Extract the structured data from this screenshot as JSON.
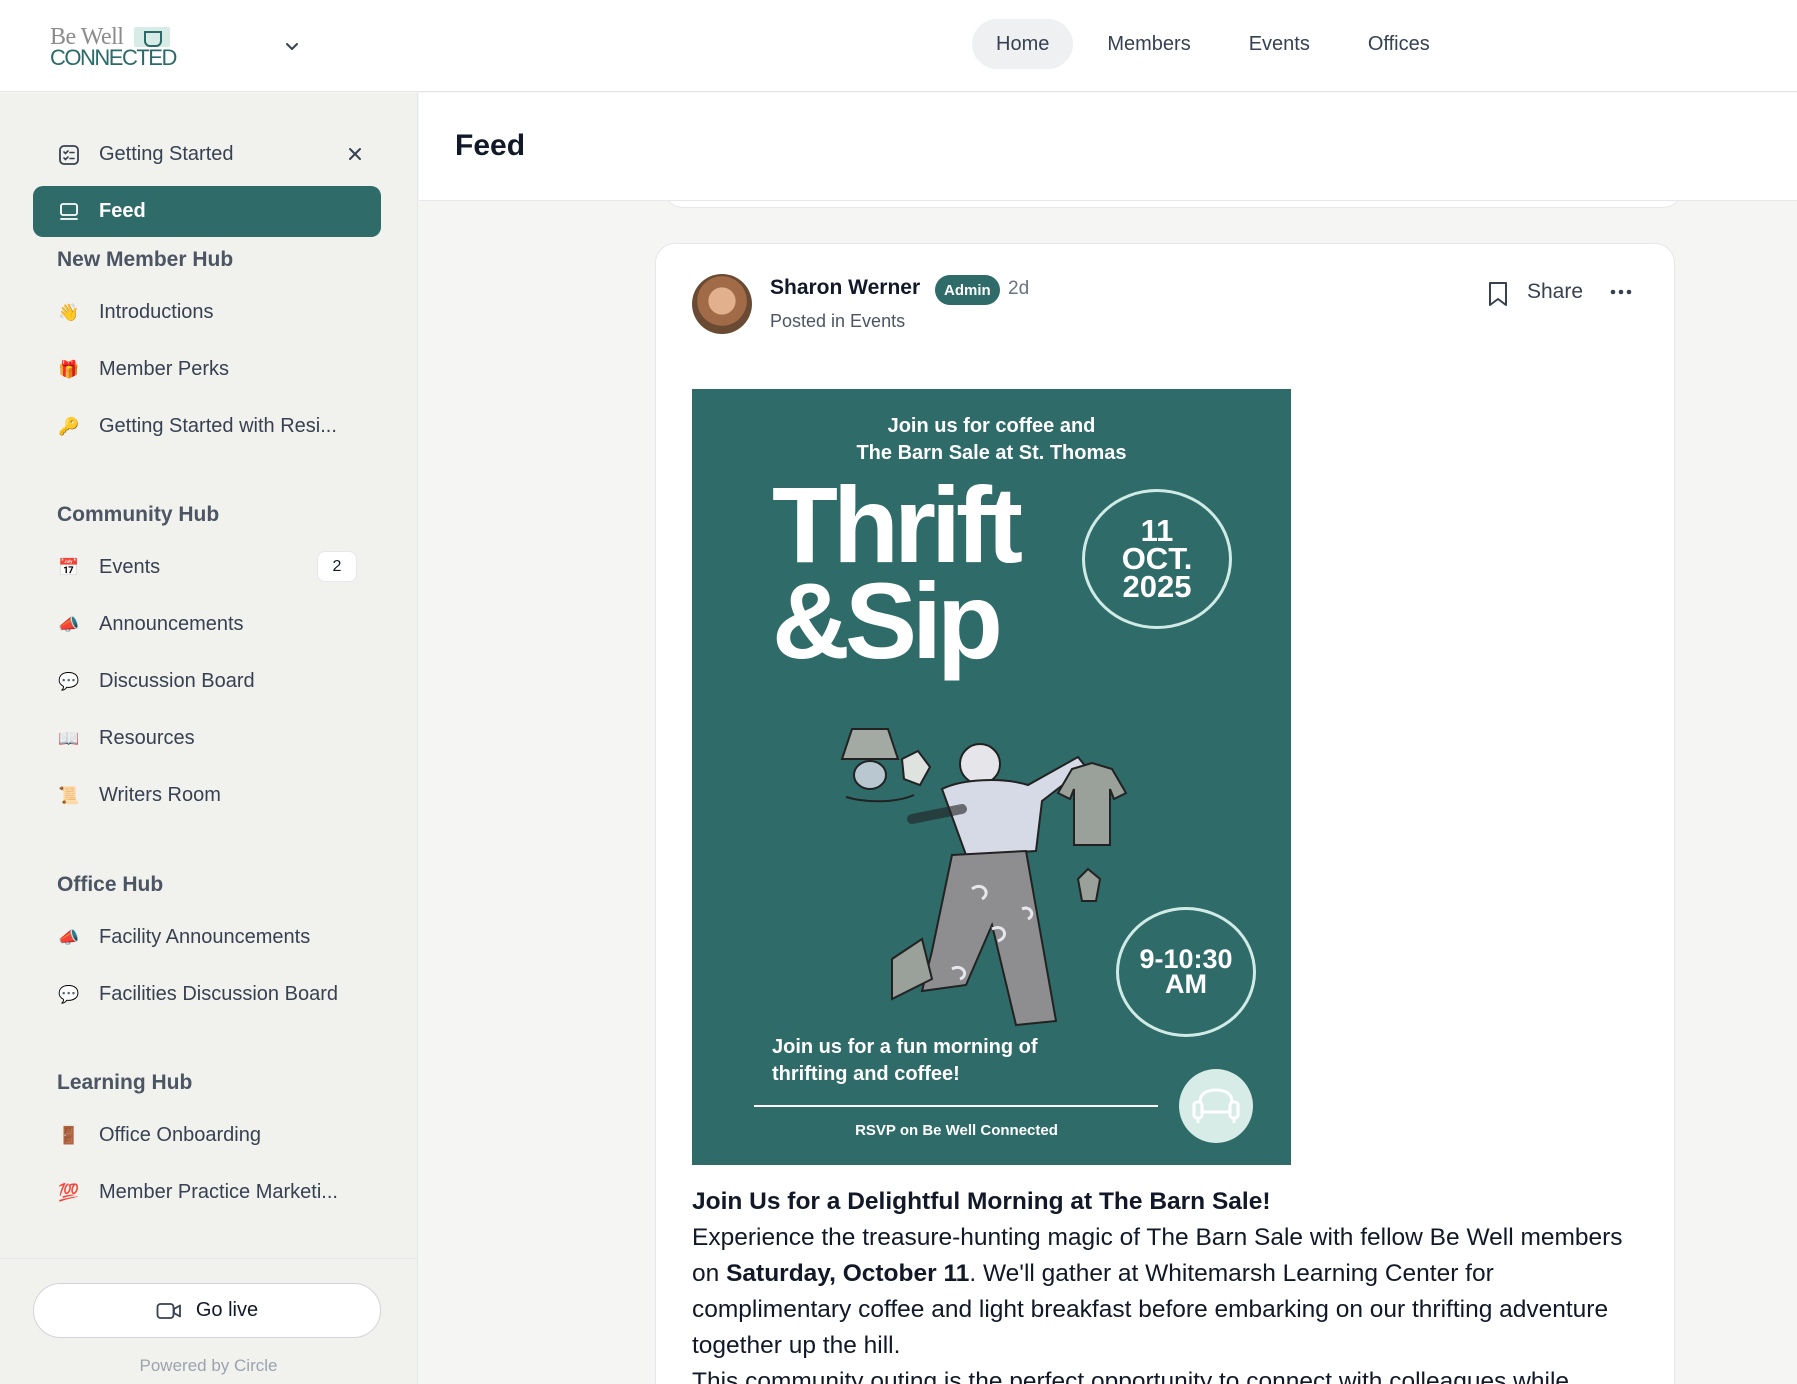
{
  "app": {
    "logo_line1": "Be Well",
    "logo_line2": "CONNECTED"
  },
  "topnav": [
    {
      "label": "Home",
      "active": true
    },
    {
      "label": "Members",
      "active": false
    },
    {
      "label": "Events",
      "active": false
    },
    {
      "label": "Offices",
      "active": false
    }
  ],
  "sidebar": {
    "getting_started": "Getting Started",
    "feed": "Feed",
    "groups": [
      {
        "heading": "New Member Hub",
        "items": [
          {
            "label": "Introductions",
            "icon": "waving-hand-icon",
            "glyph": "👋"
          },
          {
            "label": "Member Perks",
            "icon": "gift-icon",
            "glyph": "🎁"
          },
          {
            "label": "Getting Started with Resi...",
            "icon": "key-icon",
            "glyph": "🔑"
          }
        ]
      },
      {
        "heading": "Community Hub",
        "items": [
          {
            "label": "Events",
            "icon": "calendar-icon",
            "glyph": "📅",
            "badge": "2"
          },
          {
            "label": "Announcements",
            "icon": "megaphone-icon",
            "glyph": "📣"
          },
          {
            "label": "Discussion Board",
            "icon": "speech-bubble-icon",
            "glyph": "💬"
          },
          {
            "label": "Resources",
            "icon": "open-book-icon",
            "glyph": "📖"
          },
          {
            "label": "Writers Room",
            "icon": "scroll-icon",
            "glyph": "📜"
          }
        ]
      },
      {
        "heading": "Office Hub",
        "items": [
          {
            "label": "Facility Announcements",
            "icon": "megaphone-icon",
            "glyph": "📣"
          },
          {
            "label": "Facilities Discussion Board",
            "icon": "speech-bubble-icon",
            "glyph": "💬"
          }
        ]
      },
      {
        "heading": "Learning Hub",
        "items": [
          {
            "label": "Office Onboarding",
            "icon": "door-icon",
            "glyph": "🚪"
          },
          {
            "label": "Member Practice Marketi...",
            "icon": "hundred-points-icon",
            "glyph": "💯"
          }
        ]
      }
    ],
    "go_live": "Go live",
    "powered_by": "Powered by Circle"
  },
  "main": {
    "title": "Feed"
  },
  "post": {
    "author": "Sharon Werner",
    "role": "Admin",
    "age": "2d",
    "posted_in": "Posted in Events",
    "share": "Share",
    "flyer": {
      "top_line1": "Join us for coffee and",
      "top_line2": "The Barn Sale at St. Thomas",
      "title_line1": "Thrift",
      "title_line2": "&Sip",
      "date_day": "11",
      "date_month": "OCT.",
      "date_year": "2025",
      "time_line1": "9-10:30",
      "time_line2": "AM",
      "fun_line1": "Join us for a fun morning of",
      "fun_line2": "thrifting and coffee!",
      "rsvp": "RSVP on Be Well Connected"
    },
    "body_heading": "Join Us for a Delightful Morning at The Barn Sale!",
    "body_p1_a": "Experience the treasure-hunting magic of The Barn Sale with fellow Be Well members on ",
    "body_p1_bold": "Saturday, October 11",
    "body_p1_b": ". We'll gather at Whitemarsh Learning Center for complimentary coffee and light breakfast before embarking on our thrifting adventure together up the hill.",
    "body_p2": "This community outing is the perfect opportunity to connect with colleagues while"
  }
}
